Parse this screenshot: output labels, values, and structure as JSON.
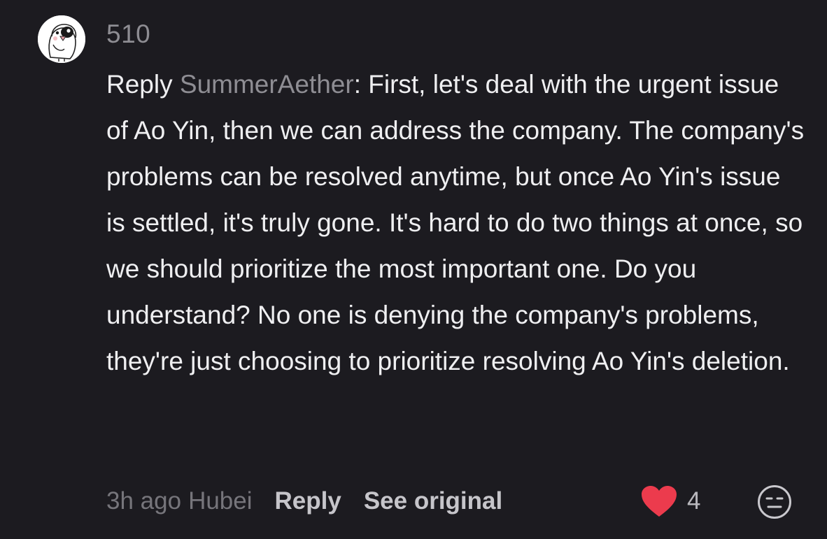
{
  "comment": {
    "username": "510",
    "reply_prefix": "Reply ",
    "mention": "SummerAether",
    "text": ": First, let's deal with the urgent issue of Ao Yin, then we can address the company. The company's problems can be resolved anytime, but once Ao Yin's issue is settled, it's truly gone. It's hard to do two things at once, so we should prioritize the most important one. Do you understand? No one is denying the company's problems, they're just choosing to prioritize resolving Ao Yin's deletion.",
    "time": "3h ago",
    "location": "Hubei",
    "reply_label": "Reply",
    "see_original_label": "See original",
    "like_count": "4",
    "liked": true
  },
  "icons": {
    "avatar": "cartoon-bird-avatar",
    "like": "heart-icon",
    "react": "emoji-face-icon"
  },
  "colors": {
    "background": "#1c1b20",
    "heart": "#ec3b4d",
    "muted_text": "#8e8d93"
  }
}
